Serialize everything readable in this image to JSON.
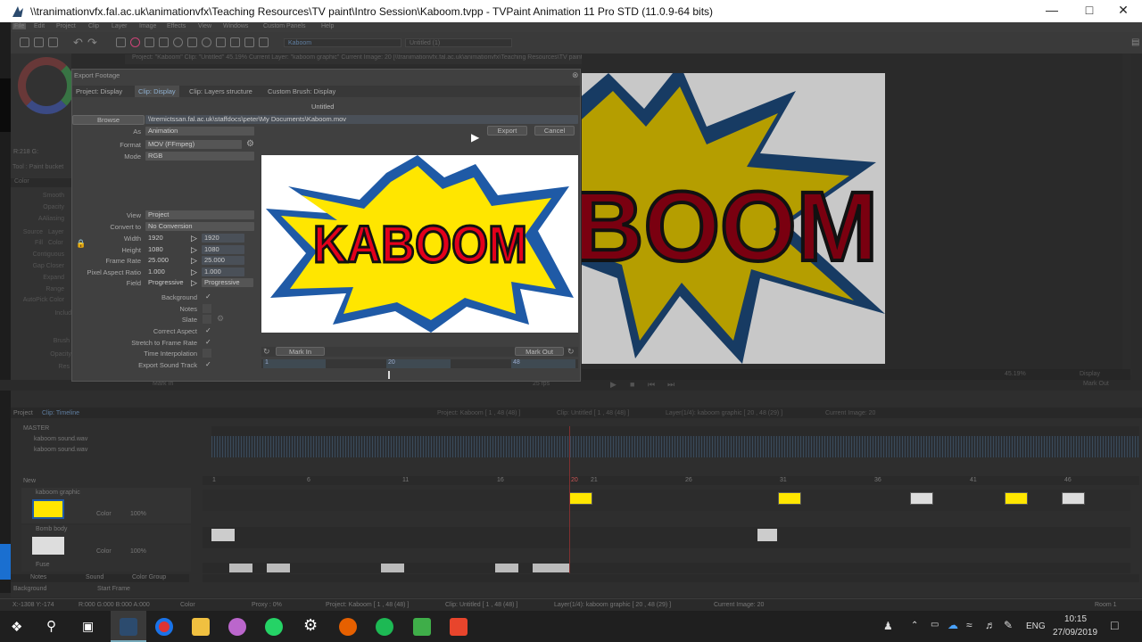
{
  "window": {
    "title": "\\\\tranimationvfx.fal.ac.uk\\animationvfx\\Teaching Resources\\TV paint\\Intro Session\\Kaboom.tvpp - TVPaint Animation 11 Pro STD (11.0.9-64 bits)"
  },
  "menu": [
    "File",
    "Edit",
    "Project",
    "Clip",
    "Layer",
    "Image",
    "Effects",
    "View",
    "Windows",
    "Custom Panels",
    "Help"
  ],
  "toolbar": {
    "project_combo": "Kaboom",
    "clip_combo": "Untitled (1)"
  },
  "infobar": "Project: \"Kaboom\"  Clip: \"Untitled\"  45.19%  Current Layer: \"kaboom graphic\"  Current Image: 20  [\\\\tranimationvfx.fal.ac.uk\\animationvfx\\Teaching Resources\\TV paint\\Intro Session\\Kaboom.tvpp]",
  "leftpanel": {
    "rgb": "R:218 G:",
    "tool": "Tool : Paint bucket",
    "color_tab": "Color",
    "labels": [
      "Smooth",
      "Opacity",
      "AAliasing",
      "Source",
      "Fill",
      "Contiguous",
      "Gap Closer",
      "Expand",
      "Range",
      "AutoPick Color",
      "Includ",
      "Brush",
      "Opacity",
      "Res"
    ],
    "source_val": "Layer",
    "fill_val": "Color"
  },
  "dialog": {
    "title": "Export Footage",
    "tabs": [
      "Project: Display",
      "Clip: Display",
      "Clip: Layers structure",
      "Custom Brush: Display"
    ],
    "name": "Untitled",
    "browse": "Browse",
    "path": "\\\\tremictssan.fal.ac.uk\\staffdocs\\peter\\My Documents\\Kaboom.mov",
    "as_label": "As",
    "as_value": "Animation",
    "export": "Export",
    "cancel": "Cancel",
    "format_label": "Format",
    "format_value": "MOV (FFmpeg)",
    "mode_label": "Mode",
    "mode_value": "RGB",
    "view_label": "View",
    "view_value": "Project",
    "convert_label": "Convert to",
    "convert_value": "No Conversion",
    "width_label": "Width",
    "width_src": "1920",
    "width_dst": "1920",
    "height_label": "Height",
    "height_src": "1080",
    "height_dst": "1080",
    "fps_label": "Frame Rate",
    "fps_src": "25.000",
    "fps_dst": "25.000",
    "par_label": "Pixel Aspect Ratio",
    "par_src": "1.000",
    "par_dst": "1.000",
    "field_label": "Field",
    "field_src": "Progressive",
    "field_dst": "Progressive",
    "checks": [
      {
        "label": "Background",
        "on": "✓"
      },
      {
        "label": "Notes",
        "on": ""
      },
      {
        "label": "Slate",
        "on": ""
      },
      {
        "label": "Correct Aspect",
        "on": "✓"
      },
      {
        "label": "Stretch to Frame Rate",
        "on": "✓"
      },
      {
        "label": "Time Interpolation",
        "on": ""
      },
      {
        "label": "Export Sound Track",
        "on": "✓"
      }
    ],
    "preview_text": "KABOOM",
    "mark_in": "Mark In",
    "mark_out": "Mark Out",
    "in_val": "1",
    "cur_val": "20",
    "out_val": "48"
  },
  "canvas": {
    "text": "BOOM",
    "zoom": "45.19%",
    "display": "Display",
    "mark_out": "Mark Out",
    "frame": "1",
    "mark_in": "Mark In",
    "fps": "25 fps"
  },
  "timeline": {
    "tabs": [
      "Project",
      "Clip: Timeline"
    ],
    "header": [
      "Project: Kaboom [ 1 , 48  (48) ]",
      "Clip: Untitled [ 1 , 48  (48) ]",
      "Layer(1/4): kaboom graphic [ 20 , 48  (29) ]",
      "Current Image: 20"
    ],
    "master": "MASTER",
    "sounds": [
      "kaboom sound.wav",
      "kaboom sound.wav"
    ],
    "new": "New",
    "ruler": [
      "1",
      "6",
      "11",
      "16",
      "20",
      "21",
      "26",
      "31",
      "36",
      "41",
      "46"
    ],
    "layers": [
      {
        "name": "kaboom graphic",
        "color_label": "Color",
        "opacity": "100%"
      },
      {
        "name": "Bomb body",
        "color_label": "Color",
        "opacity": "100%"
      },
      {
        "name": "Fuse"
      }
    ],
    "bottom_tabs": [
      "Notes",
      "Sound",
      "Color Group"
    ],
    "background": "Background",
    "start_frame": "Start Frame"
  },
  "status": {
    "coords": "X:-1308  Y:-174",
    "rgba": "R:000 G:000 B:000 A:000",
    "color": "Color",
    "proxy": "Proxy : 0%",
    "project": "Project: Kaboom [ 1 , 48  (48) ]",
    "clip": "Clip: Untitled [ 1 , 48  (48) ]",
    "layer": "Layer(1/4): kaboom graphic [ 20 , 48  (29) ]",
    "image": "Current Image: 20",
    "room": "Room 1"
  },
  "taskbar": {
    "lang": "ENG",
    "time": "10:15",
    "date": "27/09/2019",
    "apps": [
      "start-icon",
      "search-icon",
      "task-view-icon",
      "tvpaint-icon",
      "chrome-icon",
      "explorer-icon",
      "krita-icon",
      "whatsapp-icon",
      "settings-icon",
      "firefox-icon",
      "spotify-icon",
      "camtasia-icon",
      "camtasia-recorder-icon"
    ]
  },
  "colors": {
    "accent": "#5f7ea0",
    "kaboom_red": "#e3001b",
    "kaboom_yellow": "#ffe600",
    "kaboom_blue": "#1f5aa6"
  }
}
